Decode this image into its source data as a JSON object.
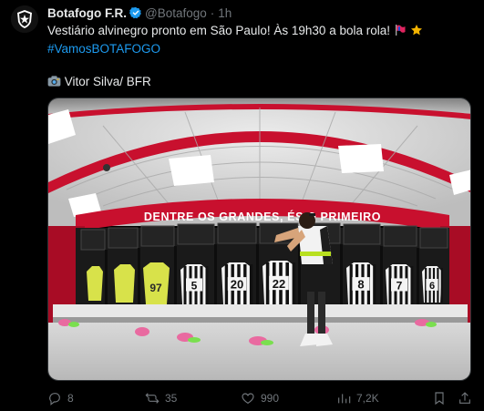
{
  "tweet": {
    "author_name": "Botafogo F.R.",
    "handle": "@Botafogo",
    "separator": "·",
    "time": "1h",
    "text": "Vestiário alvinegro pronto em São Paulo! Às 19h30 a bola rola!",
    "hashtag": "#VamosBOTAFOGO",
    "credit_text": "Vitor Silva/ BFR",
    "media": {
      "banner_text": "DENTRE OS GRANDES, ÉS O PRIMEIRO",
      "jersey_numbers": [
        "5",
        "20",
        "22",
        "8",
        "7",
        "6"
      ]
    }
  },
  "actions": {
    "replies": "8",
    "reposts": "35",
    "likes": "990",
    "views": "7,2K"
  },
  "colors": {
    "background": "#000000",
    "text": "#e7e9ea",
    "muted": "#71767b",
    "link": "#1d9bf0",
    "verified": "#1d9bf0",
    "wall_red": "#c8102e"
  },
  "icons": [
    "botafogo-crest-icon",
    "verified-badge-icon",
    "flag-emoji-icon",
    "star-emoji-icon",
    "camera-emoji-icon",
    "reply-icon",
    "repost-icon",
    "like-icon",
    "views-icon",
    "bookmark-icon",
    "share-icon"
  ]
}
